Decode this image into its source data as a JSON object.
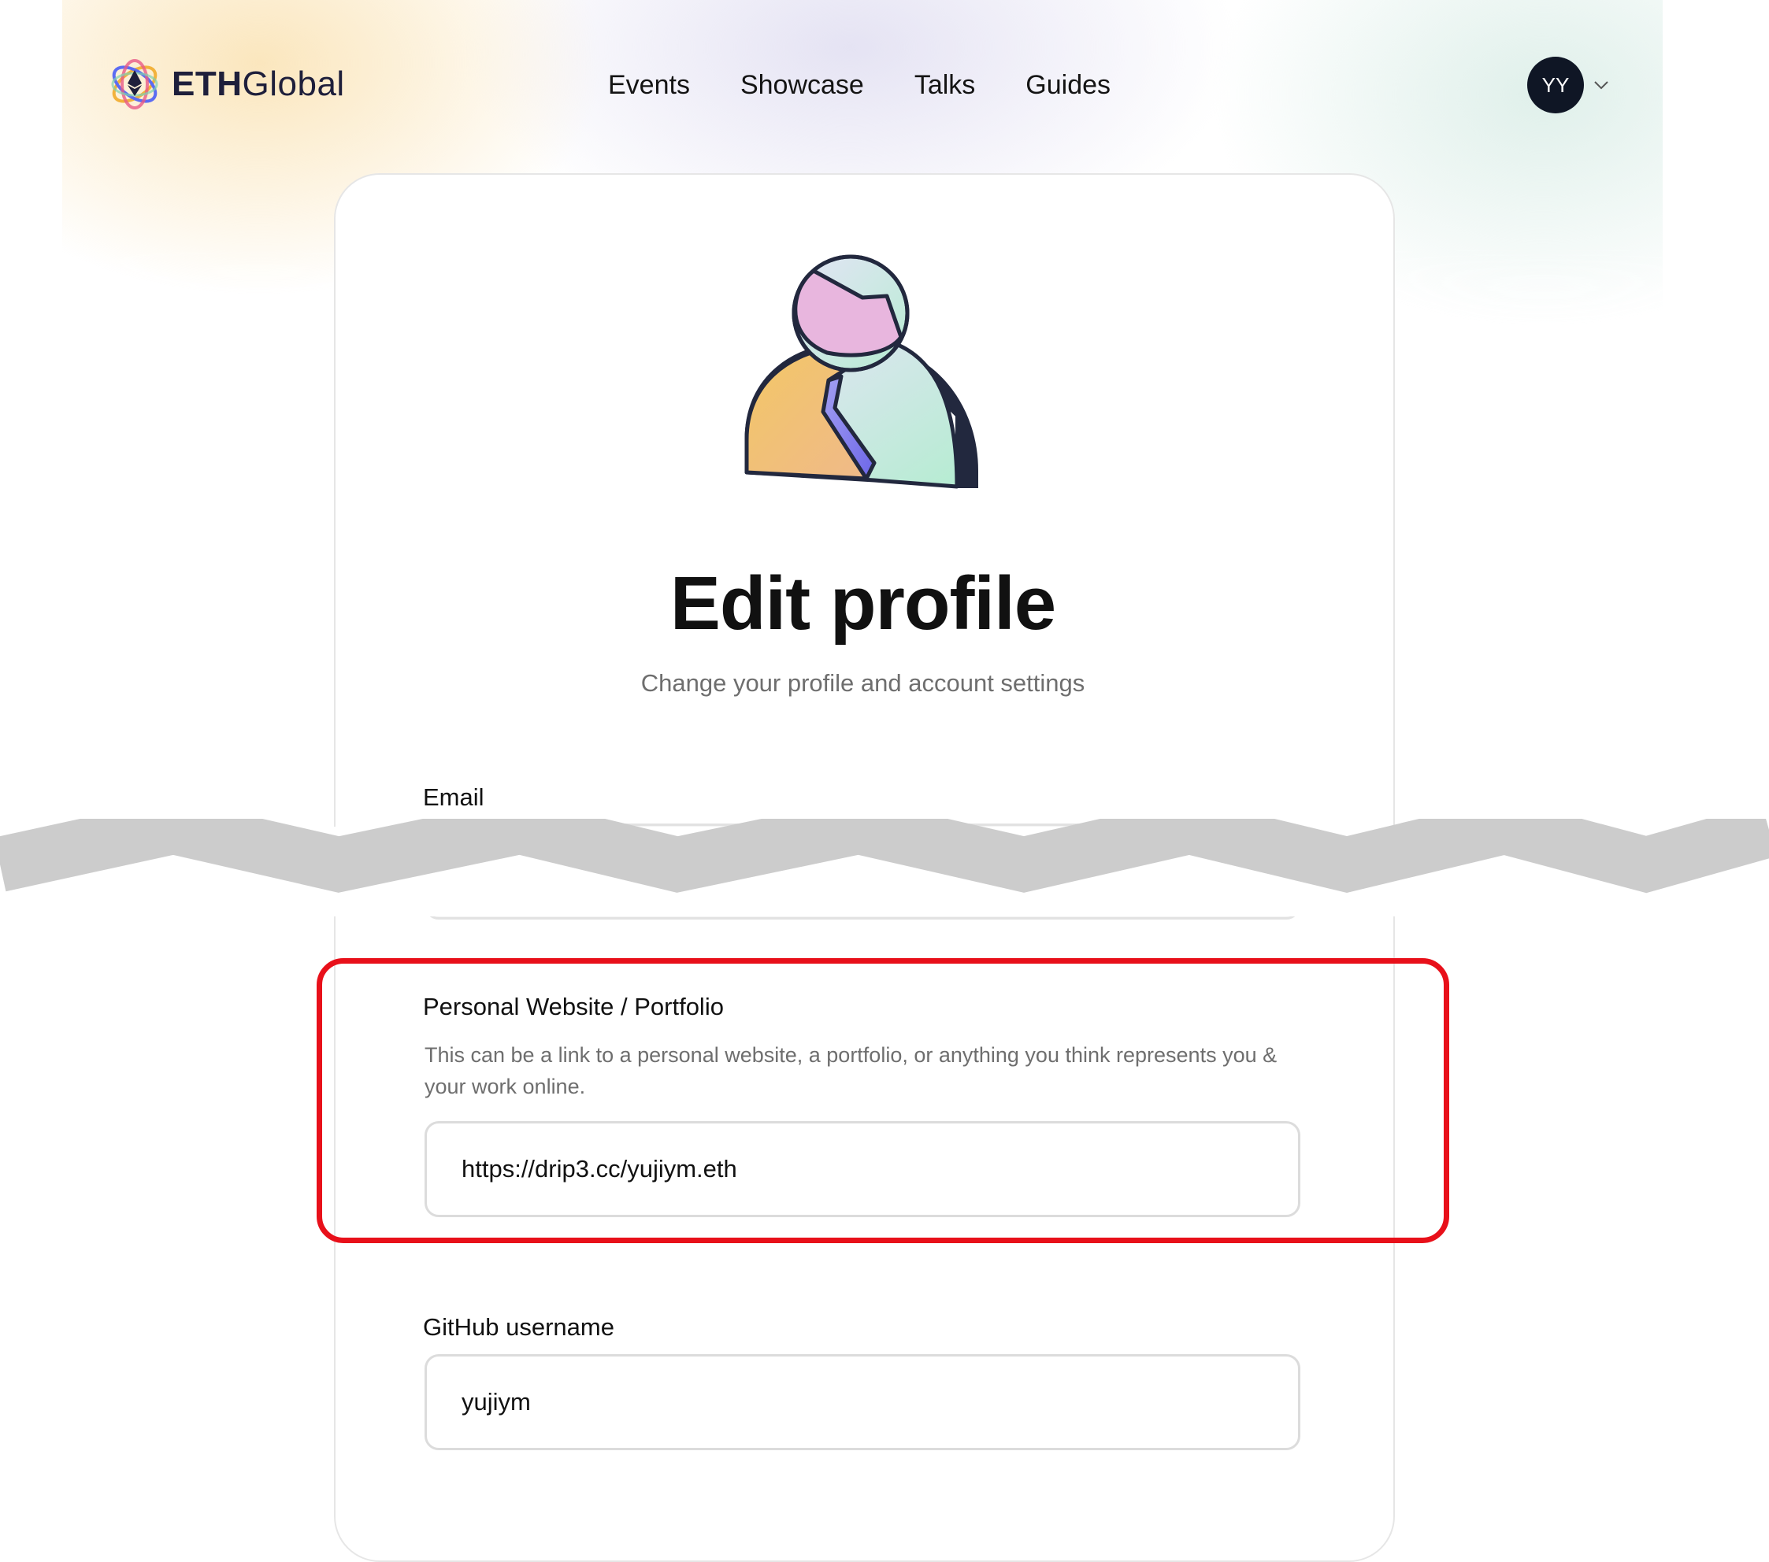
{
  "brand": {
    "name_bold": "ETH",
    "name_light": "Global"
  },
  "nav": {
    "items": [
      "Events",
      "Showcase",
      "Talks",
      "Guides"
    ]
  },
  "user": {
    "initials": "YY"
  },
  "page": {
    "title": "Edit profile",
    "subtitle": "Change your profile and account settings"
  },
  "form": {
    "email": {
      "label": "Email",
      "value": ""
    },
    "website": {
      "label": "Personal Website / Portfolio",
      "help": "This can be a link to a personal website, a portfolio, or anything you think represents you & your work online.",
      "value": "https://drip3.cc/yujiym.eth"
    },
    "github": {
      "label": "GitHub username",
      "value": "yujiym"
    }
  },
  "colors": {
    "highlight": "#e8101a",
    "avatar_bg": "#0f1625",
    "cut_band": "#cccccc"
  },
  "icons": {
    "logo": "ethglobal-logo-icon",
    "illustration": "profile-person-icon",
    "dropdown": "chevron-down-icon"
  }
}
